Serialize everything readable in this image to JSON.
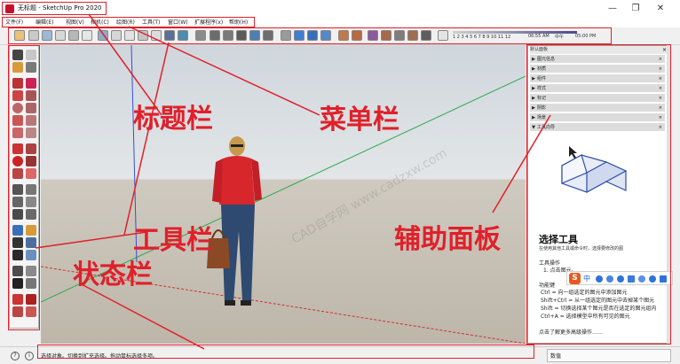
{
  "window": {
    "title": "无标题 - SketchUp Pro 2020",
    "min_glyph": "—",
    "max_glyph": "❐",
    "close_glyph": "✕"
  },
  "menu": {
    "items": [
      "文件(F)",
      "编辑(E)",
      "视图(V)",
      "相机(C)",
      "绘图(R)",
      "工具(T)",
      "窗口(W)",
      "扩展程序(x)",
      "帮助(H)"
    ]
  },
  "shadow_settings": {
    "scale_numbers": "1 2 3 4 5 6 7 8 9 10 11 12",
    "time_start": "06:55 AM",
    "time_noon": "中午",
    "time_end": "05:00 PM"
  },
  "annotations": {
    "title_bar": "标题栏",
    "menu_bar": "菜单栏",
    "toolbar": "工具栏",
    "status_bar": "状态栏",
    "tray": "辅助面板"
  },
  "colors": {
    "annotation_red": "#e0202a",
    "figure_shirt": "#d8262d",
    "figure_jeans": "#2e4a70",
    "axis_green": "#2fa84f",
    "axis_blue": "#3a4fd0",
    "axis_red": "#d03030"
  },
  "watermark": "CAD自学网 www.cadzxw.com",
  "tray": {
    "title": "默认面板",
    "close_glyph": "×",
    "panels": [
      {
        "label": "图元信息",
        "expanded": false
      },
      {
        "label": "材质",
        "expanded": false
      },
      {
        "label": "组件",
        "expanded": false
      },
      {
        "label": "样式",
        "expanded": false
      },
      {
        "label": "标记",
        "expanded": false
      },
      {
        "label": "阴影",
        "expanded": false
      },
      {
        "label": "场景",
        "expanded": false
      },
      {
        "label": "工具向导",
        "expanded": true
      }
    ],
    "instructor": {
      "tool_name": "选择工具",
      "description": "在使用其他工具或命令时，选择要修改的图",
      "operation_heading": "工具操作",
      "operation_item": "1. 点击图元。",
      "function_heading": "功能键",
      "function_lines": [
        "Ctrl = 向一组选定的图元中添加图元",
        "Shift+Ctrl = 从一组选定的图元中去掉某个图元",
        "Shift = 切换选择某个图元是否在选定的图元组内",
        "Ctrl+A = 选择模型中所有可见的图元"
      ],
      "more_link": "点击了解更多高级操作……"
    }
  },
  "ime": {
    "logo": "S",
    "mode": "中"
  },
  "status": {
    "hint": "选择对象。切换到扩充选择。拖动鼠标选择多项。",
    "measurement_label": "数值"
  }
}
